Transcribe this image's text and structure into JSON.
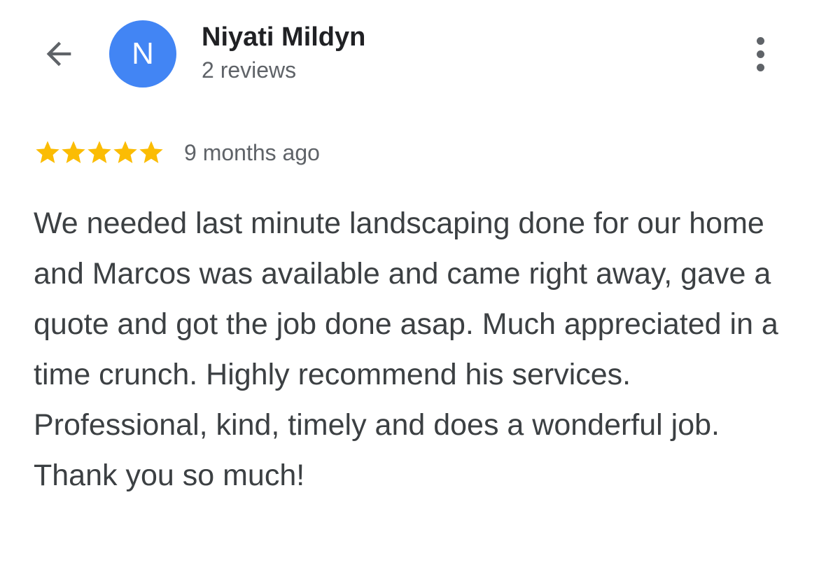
{
  "header": {
    "back_icon": "arrow-left-icon",
    "avatar_initial": "N",
    "avatar_color": "#4285f4",
    "reviewer_name": "Niyati Mildyn",
    "review_count": "2 reviews",
    "more_icon": "more-vertical-icon"
  },
  "review": {
    "rating": 5,
    "rating_max": 5,
    "star_color": "#fbbc04",
    "time_ago": "9 months ago",
    "text": "We needed last minute landscaping done for our home and Marcos was available and came right away, gave a quote and got the job done asap. Much appreciated in a time crunch. Highly recommend his services. Professional, kind, timely and does a wonderful job. Thank you so much!"
  },
  "colors": {
    "icon": "#5f6368",
    "text": "#3c4043",
    "name": "#202124"
  }
}
